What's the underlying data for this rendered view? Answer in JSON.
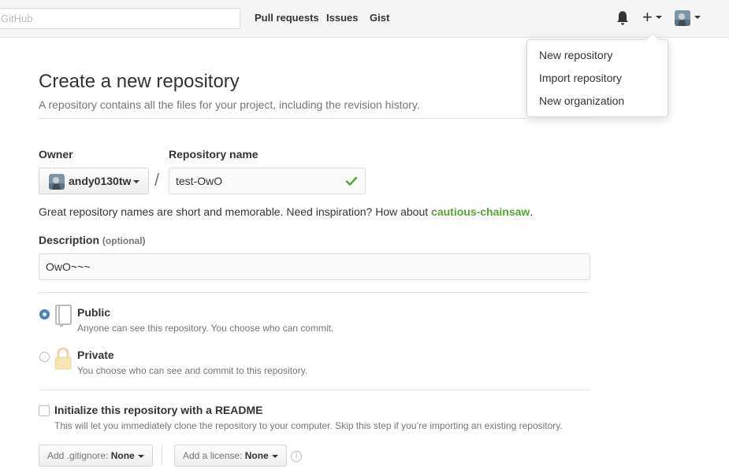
{
  "header": {
    "search_placeholder": "GitHub",
    "nav": [
      "Pull requests",
      "Issues",
      "Gist"
    ],
    "icons": [
      "bell-icon",
      "plus-icon",
      "avatar"
    ]
  },
  "dropdown": {
    "items": [
      "New repository",
      "Import repository",
      "New organization"
    ]
  },
  "page": {
    "title": "Create a new repository",
    "subtitle": "A repository contains all the files for your project, including the revision history."
  },
  "owner": {
    "label": "Owner",
    "value": "andy0130tw"
  },
  "repo": {
    "label": "Repository name",
    "value": "test-OwO",
    "separator": "/"
  },
  "suggestion": {
    "text": "Great repository names are short and memorable. Need inspiration? How about",
    "name": "cautious-chainsaw",
    "end": "."
  },
  "description": {
    "label": "Description",
    "optional": "(optional)",
    "value": "OwO~~~"
  },
  "visibility": {
    "public": {
      "title": "Public",
      "desc": "Anyone can see this repository. You choose who can commit.",
      "checked": true
    },
    "private": {
      "title": "Private",
      "desc": "You choose who can see and commit to this repository.",
      "checked": false
    }
  },
  "readme": {
    "title": "Initialize this repository with a README",
    "desc": "This will let you immediately clone the repository to your computer. Skip this step if you’re importing an existing repository.",
    "checked": false
  },
  "gitignore": {
    "label": "Add .gitignore:",
    "value": "None"
  },
  "license": {
    "label": "Add a license:",
    "value": "None"
  },
  "colors": {
    "accent": "#4183c4",
    "success": "#55a532",
    "muted": "#767676"
  }
}
